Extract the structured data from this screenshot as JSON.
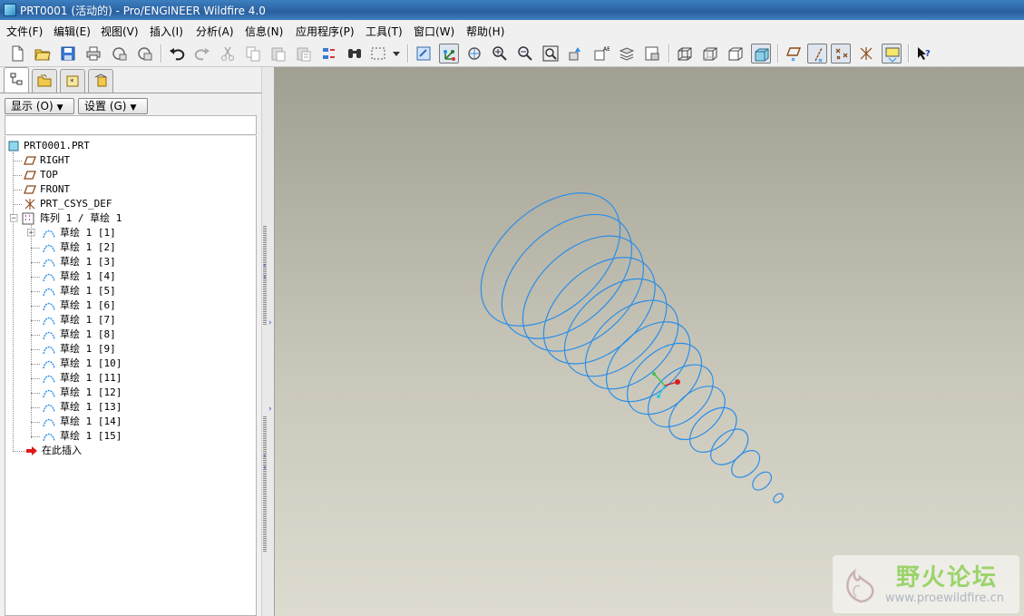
{
  "window": {
    "title": "PRT0001 (活动的) - Pro/ENGINEER Wildfire 4.0"
  },
  "menu": [
    "文件(F)",
    "编辑(E)",
    "视图(V)",
    "插入(I)",
    "分析(A)",
    "信息(N)",
    "应用程序(P)",
    "工具(T)",
    "窗口(W)",
    "帮助(H)"
  ],
  "toolbar_icons": [
    "new-icon",
    "open-icon",
    "save-icon",
    "print-icon",
    "send-mail-icon",
    "send-attach-icon",
    "undo-icon",
    "redo-icon",
    "cut-icon",
    "copy-icon",
    "paste-icon",
    "paste-special-icon",
    "regenerate-icon",
    "find-icon",
    "select-box-icon",
    "repaint-icon",
    "spin-center-icon",
    "orient-mode-icon",
    "zoom-in-icon",
    "zoom-out-icon",
    "refit-icon",
    "reorient-icon",
    "saved-views-icon",
    "layers-icon",
    "view-manager-icon",
    "wireframe-icon",
    "hidden-line-icon",
    "no-hidden-icon",
    "shading-icon",
    "datum-planes-icon",
    "datum-axes-icon",
    "datum-points-icon",
    "coord-sys-icon",
    "annotations-icon",
    "context-help-icon"
  ],
  "panel": {
    "tabs": [
      "model-tree-icon",
      "folder-browser-icon",
      "favorites-icon",
      "connections-icon"
    ],
    "show_button": "显示 (O)",
    "settings_button": "设置 (G)"
  },
  "tree": {
    "root": "PRT0001.PRT",
    "datums": [
      "RIGHT",
      "TOP",
      "FRONT"
    ],
    "csys": "PRT_CSYS_DEF",
    "pattern": "阵列 1 / 草绘 1",
    "pattern_members": [
      "草绘 1 [1]",
      "草绘 1 [2]",
      "草绘 1 [3]",
      "草绘 1 [4]",
      "草绘 1 [5]",
      "草绘 1 [6]",
      "草绘 1 [7]",
      "草绘 1 [8]",
      "草绘 1 [9]",
      "草绘 1 [10]",
      "草绘 1 [11]",
      "草绘 1 [12]",
      "草绘 1 [13]",
      "草绘 1 [14]",
      "草绘 1 [15]"
    ],
    "insert_here": "在此插入"
  },
  "graphics": {
    "curve_color": "#2a8ee8",
    "ellipse_count": 15
  },
  "watermark": {
    "title": "野火论坛",
    "url": "www.proewildfire.cn"
  }
}
